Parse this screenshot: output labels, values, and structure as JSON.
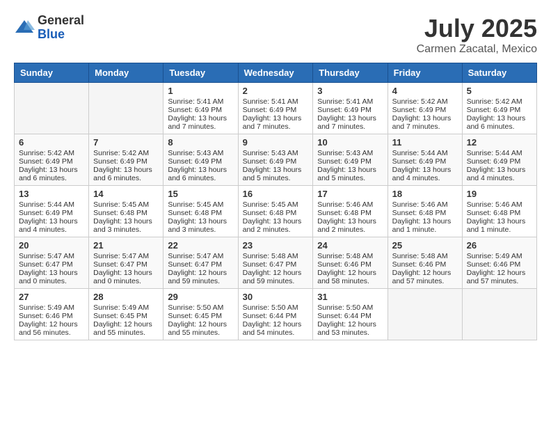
{
  "header": {
    "logo_general": "General",
    "logo_blue": "Blue",
    "month_year": "July 2025",
    "location": "Carmen Zacatal, Mexico"
  },
  "days_of_week": [
    "Sunday",
    "Monday",
    "Tuesday",
    "Wednesday",
    "Thursday",
    "Friday",
    "Saturday"
  ],
  "weeks": [
    [
      {
        "day": "",
        "info": ""
      },
      {
        "day": "",
        "info": ""
      },
      {
        "day": "1",
        "info": "Sunrise: 5:41 AM\nSunset: 6:49 PM\nDaylight: 13 hours and 7 minutes."
      },
      {
        "day": "2",
        "info": "Sunrise: 5:41 AM\nSunset: 6:49 PM\nDaylight: 13 hours and 7 minutes."
      },
      {
        "day": "3",
        "info": "Sunrise: 5:41 AM\nSunset: 6:49 PM\nDaylight: 13 hours and 7 minutes."
      },
      {
        "day": "4",
        "info": "Sunrise: 5:42 AM\nSunset: 6:49 PM\nDaylight: 13 hours and 7 minutes."
      },
      {
        "day": "5",
        "info": "Sunrise: 5:42 AM\nSunset: 6:49 PM\nDaylight: 13 hours and 6 minutes."
      }
    ],
    [
      {
        "day": "6",
        "info": "Sunrise: 5:42 AM\nSunset: 6:49 PM\nDaylight: 13 hours and 6 minutes."
      },
      {
        "day": "7",
        "info": "Sunrise: 5:42 AM\nSunset: 6:49 PM\nDaylight: 13 hours and 6 minutes."
      },
      {
        "day": "8",
        "info": "Sunrise: 5:43 AM\nSunset: 6:49 PM\nDaylight: 13 hours and 6 minutes."
      },
      {
        "day": "9",
        "info": "Sunrise: 5:43 AM\nSunset: 6:49 PM\nDaylight: 13 hours and 5 minutes."
      },
      {
        "day": "10",
        "info": "Sunrise: 5:43 AM\nSunset: 6:49 PM\nDaylight: 13 hours and 5 minutes."
      },
      {
        "day": "11",
        "info": "Sunrise: 5:44 AM\nSunset: 6:49 PM\nDaylight: 13 hours and 4 minutes."
      },
      {
        "day": "12",
        "info": "Sunrise: 5:44 AM\nSunset: 6:49 PM\nDaylight: 13 hours and 4 minutes."
      }
    ],
    [
      {
        "day": "13",
        "info": "Sunrise: 5:44 AM\nSunset: 6:49 PM\nDaylight: 13 hours and 4 minutes."
      },
      {
        "day": "14",
        "info": "Sunrise: 5:45 AM\nSunset: 6:48 PM\nDaylight: 13 hours and 3 minutes."
      },
      {
        "day": "15",
        "info": "Sunrise: 5:45 AM\nSunset: 6:48 PM\nDaylight: 13 hours and 3 minutes."
      },
      {
        "day": "16",
        "info": "Sunrise: 5:45 AM\nSunset: 6:48 PM\nDaylight: 13 hours and 2 minutes."
      },
      {
        "day": "17",
        "info": "Sunrise: 5:46 AM\nSunset: 6:48 PM\nDaylight: 13 hours and 2 minutes."
      },
      {
        "day": "18",
        "info": "Sunrise: 5:46 AM\nSunset: 6:48 PM\nDaylight: 13 hours and 1 minute."
      },
      {
        "day": "19",
        "info": "Sunrise: 5:46 AM\nSunset: 6:48 PM\nDaylight: 13 hours and 1 minute."
      }
    ],
    [
      {
        "day": "20",
        "info": "Sunrise: 5:47 AM\nSunset: 6:47 PM\nDaylight: 13 hours and 0 minutes."
      },
      {
        "day": "21",
        "info": "Sunrise: 5:47 AM\nSunset: 6:47 PM\nDaylight: 13 hours and 0 minutes."
      },
      {
        "day": "22",
        "info": "Sunrise: 5:47 AM\nSunset: 6:47 PM\nDaylight: 12 hours and 59 minutes."
      },
      {
        "day": "23",
        "info": "Sunrise: 5:48 AM\nSunset: 6:47 PM\nDaylight: 12 hours and 59 minutes."
      },
      {
        "day": "24",
        "info": "Sunrise: 5:48 AM\nSunset: 6:46 PM\nDaylight: 12 hours and 58 minutes."
      },
      {
        "day": "25",
        "info": "Sunrise: 5:48 AM\nSunset: 6:46 PM\nDaylight: 12 hours and 57 minutes."
      },
      {
        "day": "26",
        "info": "Sunrise: 5:49 AM\nSunset: 6:46 PM\nDaylight: 12 hours and 57 minutes."
      }
    ],
    [
      {
        "day": "27",
        "info": "Sunrise: 5:49 AM\nSunset: 6:46 PM\nDaylight: 12 hours and 56 minutes."
      },
      {
        "day": "28",
        "info": "Sunrise: 5:49 AM\nSunset: 6:45 PM\nDaylight: 12 hours and 55 minutes."
      },
      {
        "day": "29",
        "info": "Sunrise: 5:50 AM\nSunset: 6:45 PM\nDaylight: 12 hours and 55 minutes."
      },
      {
        "day": "30",
        "info": "Sunrise: 5:50 AM\nSunset: 6:44 PM\nDaylight: 12 hours and 54 minutes."
      },
      {
        "day": "31",
        "info": "Sunrise: 5:50 AM\nSunset: 6:44 PM\nDaylight: 12 hours and 53 minutes."
      },
      {
        "day": "",
        "info": ""
      },
      {
        "day": "",
        "info": ""
      }
    ]
  ]
}
